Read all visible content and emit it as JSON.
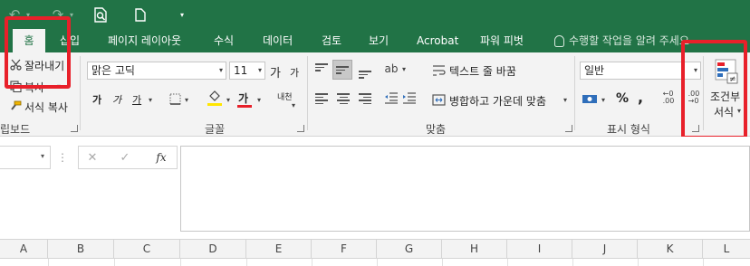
{
  "tabs": [
    {
      "label": "홈",
      "active": true
    },
    {
      "label": "삽입"
    },
    {
      "label": "페이지 레이아웃"
    },
    {
      "label": "수식"
    },
    {
      "label": "데이터"
    },
    {
      "label": "검토"
    },
    {
      "label": "보기"
    },
    {
      "label": "Acrobat"
    },
    {
      "label": "파워 피벗"
    }
  ],
  "tell_me": "수행할 작업을 알려 주세요",
  "clipboard": {
    "cut": "잘라내기",
    "copy": "복사",
    "format_painter": "서식 복사",
    "label": "립보드"
  },
  "font": {
    "name": "맑은 고딕",
    "size": "11",
    "grow": "가",
    "shrink": "가",
    "bold": "가",
    "italic": "가",
    "underline": "가",
    "font_color": "가",
    "phonetic": "내천",
    "label": "글꼴"
  },
  "alignment": {
    "wrap_text": "텍스트 줄 바꿈",
    "merge_center": "병합하고 가운데 맞춤",
    "label": "맞춤"
  },
  "number": {
    "format": "일반",
    "percent": "%",
    "comma": ",",
    "label": "표시 형식"
  },
  "styles": {
    "conditional_line1": "조건부",
    "conditional_line2": "서식"
  },
  "formula_bar": {
    "fx": "fx"
  },
  "columns": [
    "A",
    "B",
    "C",
    "D",
    "E",
    "F",
    "G",
    "H",
    "I",
    "J",
    "K",
    "L"
  ],
  "colors": {
    "brand": "#217346",
    "highlight": "#e8202a",
    "font_color_bar": "#e8202a",
    "fill_color_bar": "#ffe600"
  }
}
